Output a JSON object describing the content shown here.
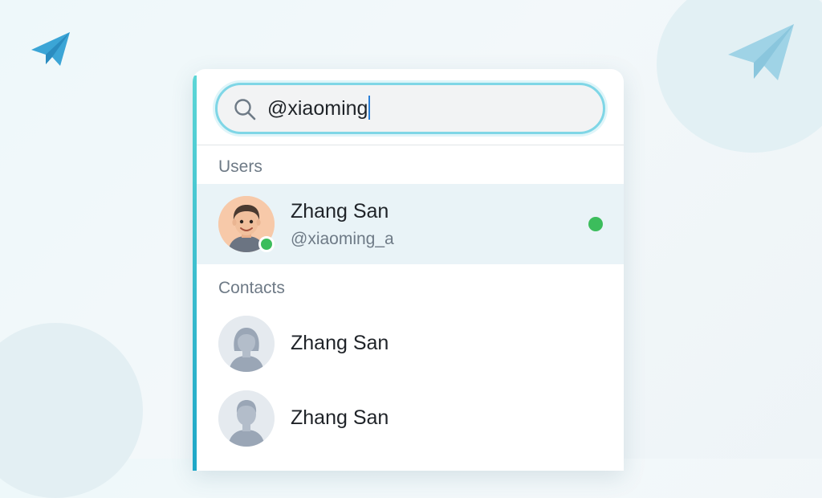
{
  "search": {
    "value": "@xiaoming",
    "icon": "search-icon"
  },
  "sections": {
    "users_label": "Users",
    "contacts_label": "Contacts"
  },
  "users": [
    {
      "name": "Zhang San",
      "handle": "@xiaoming_a",
      "online": true,
      "avatar": "memoji-avatar"
    }
  ],
  "contacts": [
    {
      "name": "Zhang San",
      "avatar": "female-silhouette-avatar"
    },
    {
      "name": "Zhang San",
      "avatar": "male-silhouette-avatar"
    }
  ],
  "colors": {
    "accent": "#1ea7c7",
    "online": "#3cbd5c",
    "highlight": "#e9f3f7",
    "search_border": "#7fd6e6",
    "telegram": "#3ba5d6"
  }
}
